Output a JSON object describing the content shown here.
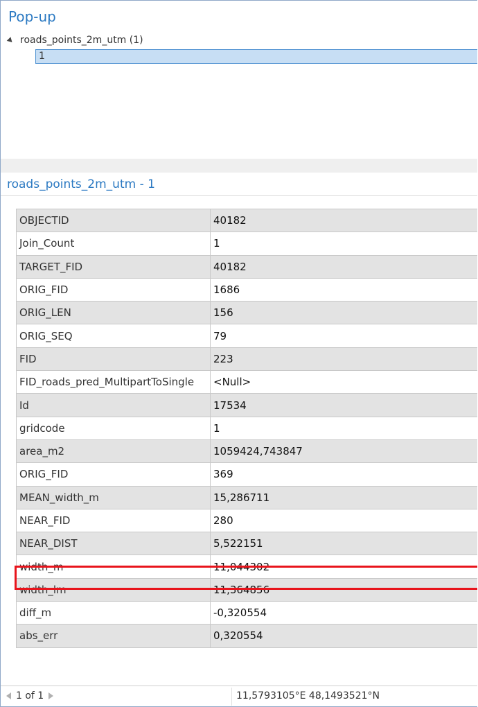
{
  "panel": {
    "title": "Pop-up",
    "layer_label": "roads_points_2m_utm (1)",
    "feature_label": "1"
  },
  "detail": {
    "title": "roads_points_2m_utm - 1",
    "rows": [
      {
        "field": "OBJECTID",
        "value": "40182"
      },
      {
        "field": "Join_Count",
        "value": "1"
      },
      {
        "field": "TARGET_FID",
        "value": "40182"
      },
      {
        "field": "ORIG_FID",
        "value": "1686"
      },
      {
        "field": "ORIG_LEN",
        "value": "156"
      },
      {
        "field": "ORIG_SEQ",
        "value": "79"
      },
      {
        "field": "FID",
        "value": "223"
      },
      {
        "field": "FID_roads_pred_MultipartToSingle",
        "value": "<Null>"
      },
      {
        "field": "Id",
        "value": "17534"
      },
      {
        "field": "gridcode",
        "value": "1"
      },
      {
        "field": "area_m2",
        "value": "1059424,743847"
      },
      {
        "field": "ORIG_FID",
        "value": "369"
      },
      {
        "field": "MEAN_width_m",
        "value": "15,286711"
      },
      {
        "field": "NEAR_FID",
        "value": "280"
      },
      {
        "field": "NEAR_DIST",
        "value": "5,522151"
      },
      {
        "field": "width_m",
        "value": "11,044302"
      },
      {
        "field": "width_lm",
        "value": "11,364856"
      },
      {
        "field": "diff_m",
        "value": "-0,320554"
      },
      {
        "field": "abs_err",
        "value": "0,320554"
      }
    ],
    "highlight_color": "#e8141c"
  },
  "footer": {
    "pager": "1 of 1",
    "coordinates": "11,5793105°E 48,1493521°N"
  },
  "colors": {
    "accent": "#2b79c2",
    "selection": "#c7def4"
  }
}
